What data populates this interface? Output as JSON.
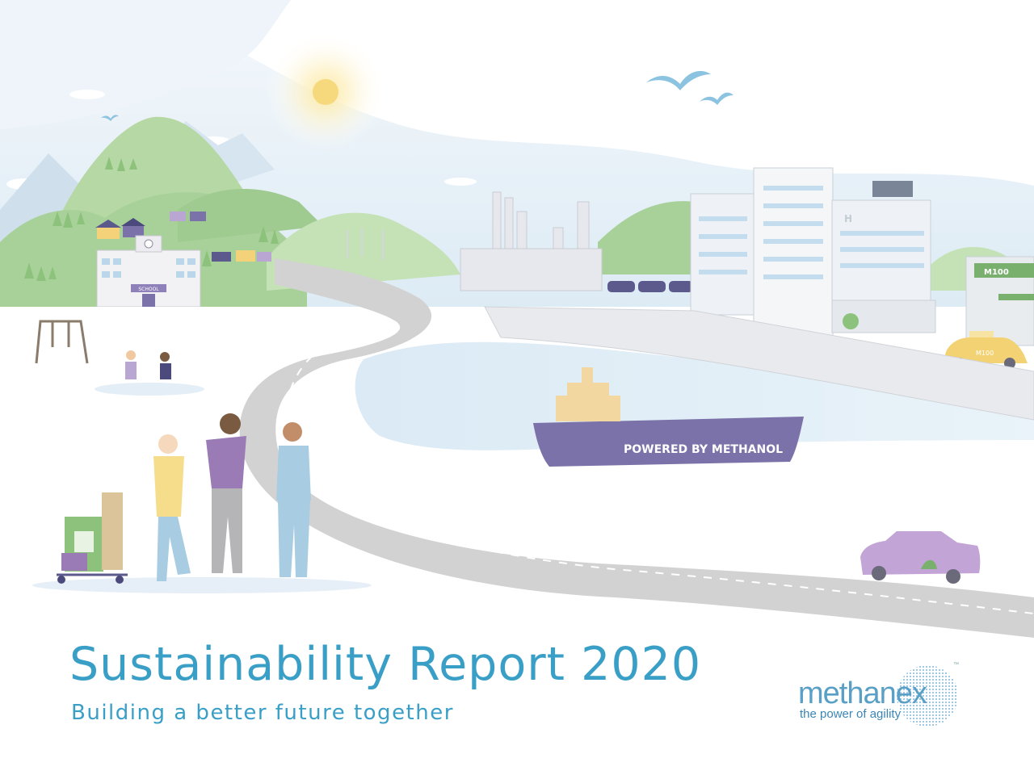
{
  "report": {
    "title": "Sustainability Report 2020",
    "subtitle": "Building a better future together"
  },
  "brand": {
    "wordmark": "methanex",
    "tagline": "the power of agility",
    "trademark": "™"
  },
  "scene_labels": {
    "school_sign": "SCHOOL",
    "ship_text": "POWERED BY METHANOL",
    "fuel_station_sign": "M100",
    "taxi_sign": "M100",
    "hospital_letter": "H"
  },
  "colors": {
    "title_blue": "#3a9fc7",
    "brand_blue": "#5aa0c6",
    "hill_green": "#a8d19a",
    "ship_purple": "#7a72a8",
    "road_gray": "#cfcfcf",
    "water_blue": "#d9ebf5"
  }
}
